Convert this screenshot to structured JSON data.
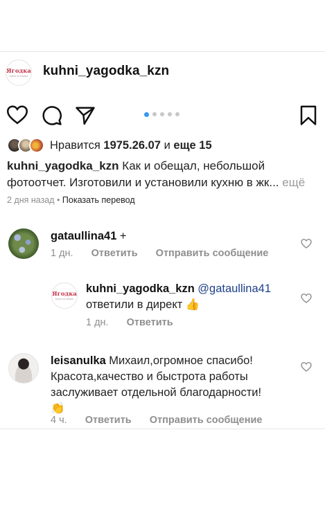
{
  "post": {
    "username": "kuhni_yagodka_kzn",
    "logo_text": "Ягодка",
    "logo_subtext": "Кухни на Казани",
    "carousel": {
      "total": 5,
      "active": 1
    },
    "likes": {
      "prefix": "Нравится",
      "user": "1975.26.07",
      "joiner": "и",
      "others": "еще 15"
    },
    "caption": {
      "username": "kuhni_yagodka_kzn",
      "text": "Как и обещал, небольшой фотоотчет. Изготовили и установили кухню в жк...",
      "more": "ещё"
    },
    "time": "2 дня назад",
    "separator": "•",
    "translate": "Показать перевод"
  },
  "comments": [
    {
      "username": "gataullina41",
      "text": "+",
      "time": "1 дн.",
      "reply": "Ответить",
      "message": "Отправить сообщение"
    },
    {
      "username": "kuhni_yagodka_kzn",
      "mention": "@gataullina41",
      "text": "ответили в директ",
      "emoji": "👍",
      "time": "1 дн.",
      "reply": "Ответить"
    },
    {
      "username": "leisanulka",
      "text": "Михаил,огромное спасибо! Красота,качество и быстрота работы заслуживает отдельной благодарности!",
      "emoji": "👏",
      "time": "4 ч.",
      "reply": "Ответить",
      "message": "Отправить сообщение"
    }
  ],
  "icons": {
    "like": "heart-icon",
    "comment": "comment-icon",
    "share": "send-icon",
    "save": "bookmark-icon",
    "comment_like": "heart-outline-icon"
  },
  "colors": {
    "accent_blue": "#3897f0",
    "mention": "#1d3f8a",
    "muted": "#8e8e8e",
    "brand": "#c23247"
  }
}
